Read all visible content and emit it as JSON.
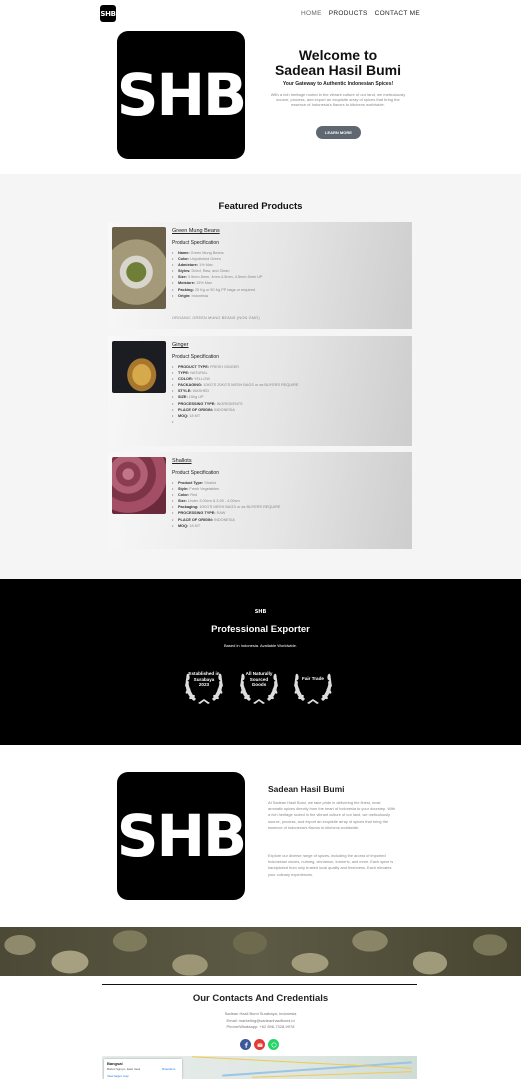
{
  "header": {
    "logo_text": "SHB",
    "nav": [
      "HOME",
      "PRODUCTS",
      "CONTACT ME"
    ]
  },
  "hero": {
    "logo_text": "SHB",
    "title_line1": "Welcome to",
    "title_line2": "Sadean Hasil Bumi",
    "subtitle": "Your Gateway to Authentic Indonesian Spices!",
    "description": "With a rich heritage rooted in the vibrant culture of our land, we meticulously source, process, and export an exquisite array of spices that bring the essence of Indonesia's flavors to kitchens worldwide.",
    "button": "LEARN MORE"
  },
  "featured": {
    "title": "Featured Products",
    "products": [
      {
        "name": "Green Mung Beans",
        "spec_title": "Product Specification",
        "specs": [
          [
            "Name:",
            " Green Mung Beans"
          ],
          [
            "Color:",
            " Unpolished Green"
          ],
          [
            "Admixture:",
            " 1% Max"
          ],
          [
            "Styles:",
            " Dried, Raw, and Clean"
          ],
          [
            "Size:",
            " 3.5mm-5mm, 4mm-4.5mm, 4.5mm-5mm UP"
          ],
          [
            "Moisture:",
            " 15% Max"
          ],
          [
            "Packing:",
            " 25 Kg or 50 Kg PP bags or required"
          ],
          [
            "Origin:",
            " Indonesia"
          ]
        ],
        "extra": "ORGANIC GREEN MUNG BEANS (NON GMO)"
      },
      {
        "name": "Ginger",
        "spec_title": "Product Specification",
        "specs": [
          [
            "PRODUCT TYPE:",
            " FRESH GINGER"
          ],
          [
            "TYPE:",
            " NATURAL"
          ],
          [
            "COLOR:",
            " YELLOW"
          ],
          [
            "PACKAGING:",
            " 10KG'S 20KG'S MESH BAGS or as BUYERS REQUIRE"
          ],
          [
            "STYLE:",
            " WASHED"
          ],
          [
            "SIZE:",
            " 150g UP"
          ],
          [
            "PROCESSING TYPE:",
            " INGREDIENTS"
          ],
          [
            "PLACE OF ORIGIN:",
            " INDONESIA"
          ],
          [
            "MOQ:",
            " 18 MT"
          ],
          [
            "",
            ""
          ]
        ],
        "extra": ""
      },
      {
        "name": "Shallots",
        "spec_title": "Product Specification",
        "specs": [
          [
            "Product Type:",
            " Shallot"
          ],
          [
            "Style:",
            " Fresh Vegetables"
          ],
          [
            "Color:",
            " Red"
          ],
          [
            "Size:",
            " Under 3.00cm & 3.00 - 4.00cm"
          ],
          [
            "Packaging:",
            " 10KG'S MESH BAGS or as BUYERS REQUIRE"
          ],
          [
            "PROCESSING TYPE:",
            " RAW"
          ],
          [
            "PLACE OF ORIGIN:",
            " INDONESIA"
          ],
          [
            "MOQ:",
            " 18 MT"
          ]
        ],
        "extra": ""
      }
    ]
  },
  "exporter": {
    "logo_text": "SHB",
    "title": "Professional Exporter",
    "subtitle": "Based in Indonesia. Available Worldwide.",
    "badges": [
      "Established in Surabaya 2023",
      "All Naturally Sourced Goods",
      "Fair Trade"
    ]
  },
  "about": {
    "logo_text": "SHB",
    "title": "Sadean Hasil Bumi",
    "paragraph1": "At Sadean Hasil Bumi, we take pride in delivering the finest, most aromatic spices directly from the heart of Indonesia to your doorstep. With a rich heritage rooted in the vibrant culture of our land, we meticulously source, process, and export an exquisite array of spices that bring the essence of Indonesia's flavors to kitchens worldwide.",
    "paragraph2": "Explore our diverse range of spices, including the aroma of imported Indonesian cloves, nutmeg, cinnamon, turmeric, and more. Each spice is handpicked from only trusted local quality and freshness. Each elevates your culinary experiences."
  },
  "contacts": {
    "title": "Our Contacts And Credentials",
    "address": "Sadean Hasil Bumi Surabaya, Indonesia",
    "email": "Email: marketing@sadeanhasilbumi.id",
    "phone": "Phone/Whatsapp: +62 896-7328-9978",
    "map_title": "Bangsal",
    "map_sub": "Bobot Ngroyo, East Java",
    "map_link": "View larger map",
    "map_dir": "Directions",
    "colors": {
      "facebook": "#3b5998",
      "email": "#e53935",
      "whatsapp": "#25d366"
    }
  }
}
